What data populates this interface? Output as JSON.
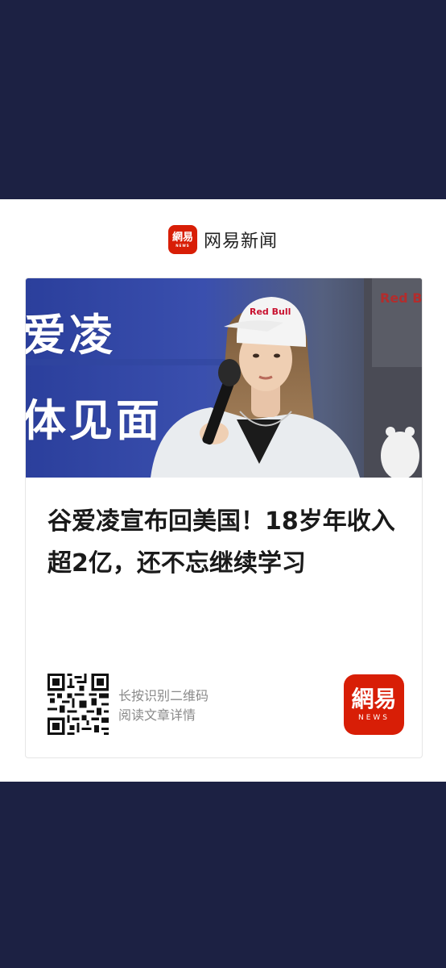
{
  "brand": {
    "name": "网易新闻",
    "logo_text": "網易",
    "logo_sub": "NEWS"
  },
  "hero": {
    "line1": "爱凌",
    "line2": "体见面",
    "cap_text": "Red Bull",
    "banner_text": "Red B"
  },
  "article": {
    "headline": "谷爱凌宣布回美国！18岁年收入超2亿，还不忘继续学习"
  },
  "footer": {
    "qr_line1": "长按识别二维码",
    "qr_line2": "阅读文章详情",
    "app_logo_text": "網易",
    "app_logo_sub": "NEWS"
  },
  "colors": {
    "background": "#1c2143",
    "brand_red": "#d81e06",
    "text": "#1a1a1a",
    "muted": "#8a8a8a"
  }
}
